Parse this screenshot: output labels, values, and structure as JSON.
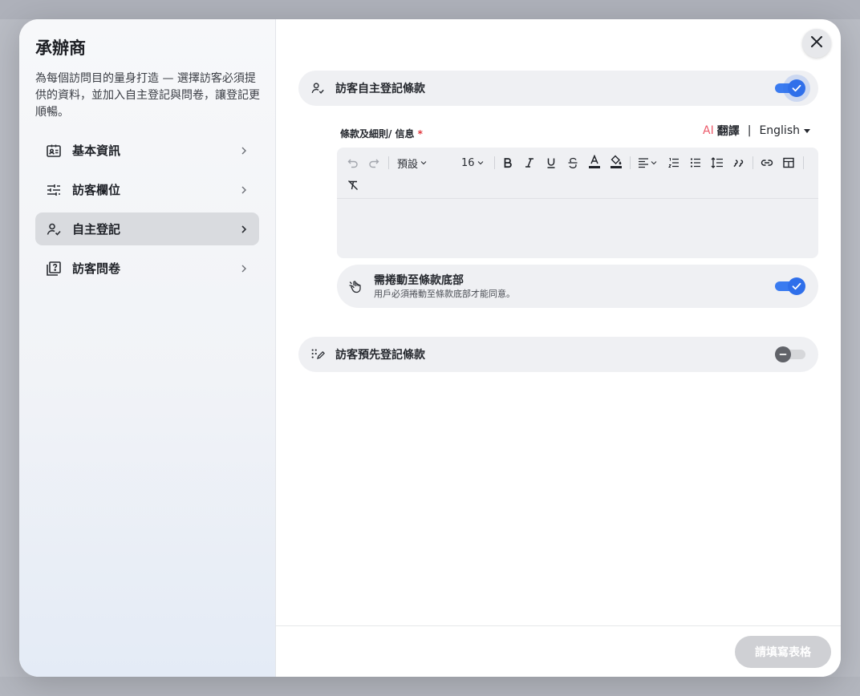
{
  "sidebar": {
    "title": "承辦商",
    "description": "為每個訪問目的量身打造 — 選擇訪客必須提供的資料，並加入自主登記與問卷，讓登記更順暢。",
    "items": [
      {
        "label": "基本資訊",
        "icon": "id-card-icon",
        "active": false
      },
      {
        "label": "訪客欄位",
        "icon": "sliders-icon",
        "active": false
      },
      {
        "label": "自主登記",
        "icon": "user-check-icon",
        "active": true
      },
      {
        "label": "訪客問卷",
        "icon": "question-board-icon",
        "active": false
      }
    ]
  },
  "main": {
    "self_registration_terms": {
      "label": "訪客自主登記條款",
      "enabled": true
    },
    "terms_field": {
      "label": "條款及細則/ 信息",
      "required_mark": "*"
    },
    "translate": {
      "ai_label": "AI",
      "label": "翻譯",
      "separator": "|",
      "language": "English"
    },
    "toolbar": {
      "block_style": "預設",
      "font_size": "16"
    },
    "scroll_to_bottom": {
      "title": "需捲動至條款底部",
      "description": "用戶必須捲動至條款底部才能同意。",
      "enabled": true
    },
    "pre_registration_terms": {
      "label": "訪客預先登記條款",
      "enabled": false
    }
  },
  "footer": {
    "submit_label": "請填寫表格"
  },
  "colors": {
    "accent": "#2f6fea",
    "required": "#e0383e",
    "ai": "#ec5b6b"
  }
}
